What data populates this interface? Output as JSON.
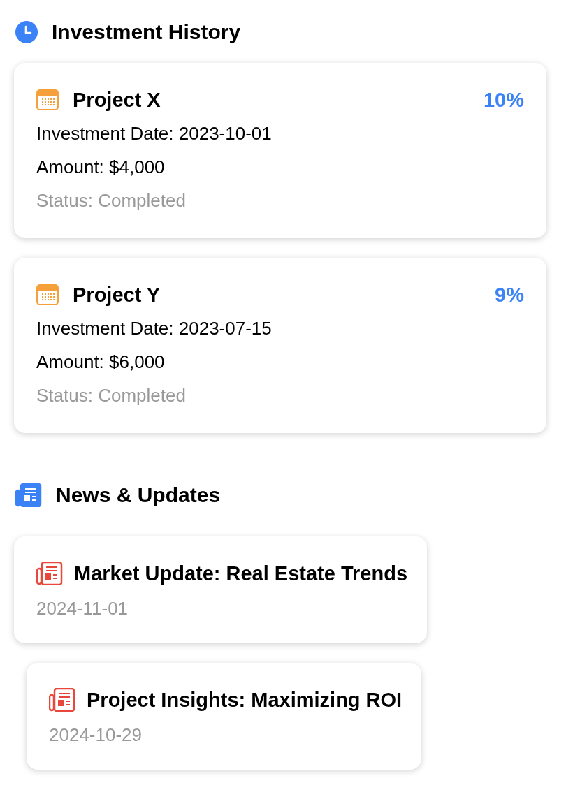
{
  "investment_history": {
    "title": "Investment History",
    "items": [
      {
        "name": "Project X",
        "percent": "10%",
        "date": "Investment Date: 2023-10-01",
        "amount": "Amount: $4,000",
        "status": "Status: Completed"
      },
      {
        "name": "Project Y",
        "percent": "9%",
        "date": "Investment Date: 2023-07-15",
        "amount": "Amount: $6,000",
        "status": "Status: Completed"
      }
    ]
  },
  "news": {
    "title": "News & Updates",
    "items": [
      {
        "title": "Market Update: Real Estate Trends",
        "date": "2024-11-01"
      },
      {
        "title": "Project Insights: Maximizing ROI",
        "date": "2024-10-29"
      }
    ]
  }
}
